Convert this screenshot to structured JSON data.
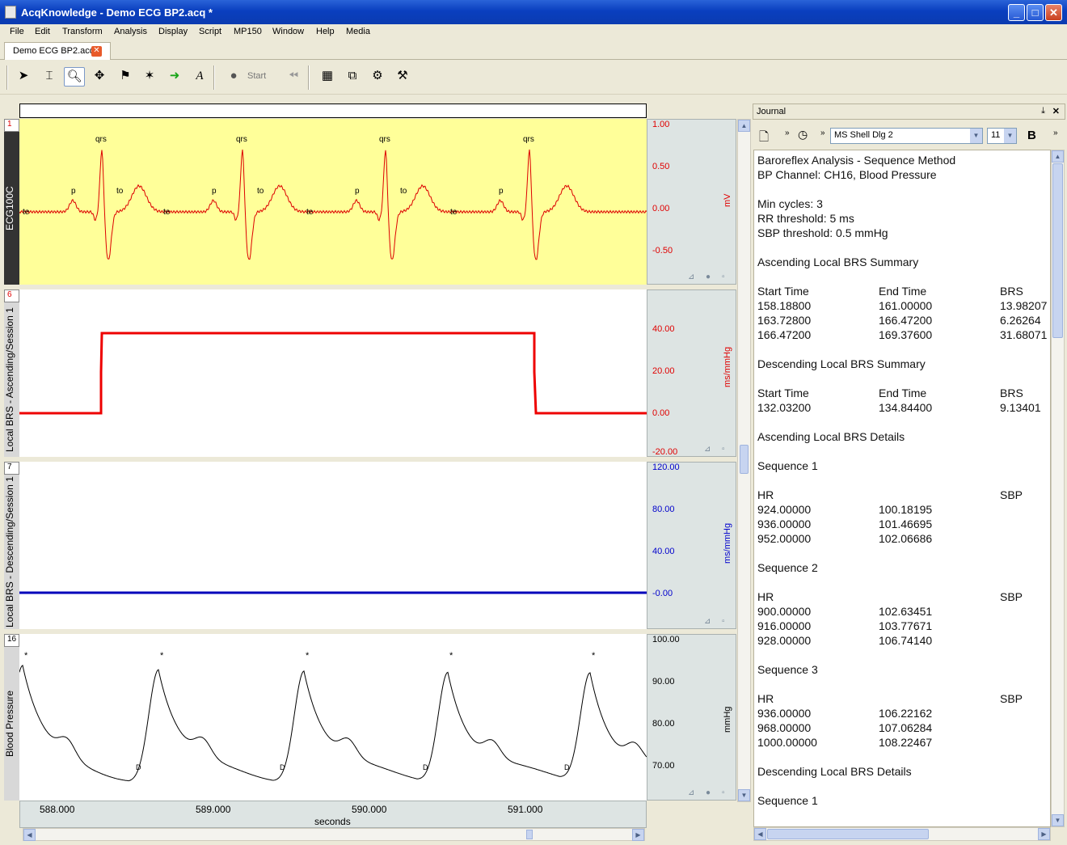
{
  "window": {
    "title": "AcqKnowledge - Demo ECG BP2.acq *"
  },
  "menu": [
    "File",
    "Edit",
    "Transform",
    "Analysis",
    "Display",
    "Script",
    "MP150",
    "Window",
    "Help",
    "Media"
  ],
  "doc_tab": {
    "label": "Demo ECG BP2.acq"
  },
  "toolbar": {
    "start_label": "Start"
  },
  "channels": [
    {
      "num": "1",
      "name": "ECG100C",
      "unit": "mV",
      "ticks": [
        "1.00",
        "0.50",
        "0.00",
        "-0.50"
      ],
      "tick_color": "#e00000",
      "bg": "#ffff99",
      "trace_color": "#dd0000"
    },
    {
      "num": "6",
      "name": "Local BRS - Ascending/Session 1",
      "unit": "ms/mmHg",
      "ticks": [
        "40.00",
        "20.00",
        "0.00",
        "-20.00"
      ],
      "tick_color": "#e00000",
      "bg": "#ffffff",
      "trace_color": "#ee0000"
    },
    {
      "num": "7",
      "name": "Local BRS - Descending/Session 1",
      "unit": "ms/mmHg",
      "ticks": [
        "120.00",
        "80.00",
        "40.00",
        "-0.00"
      ],
      "tick_color": "#0000cc",
      "bg": "#ffffff",
      "trace_color": "#0000bb"
    },
    {
      "num": "16",
      "name": "Blood Pressure",
      "unit": "mmHg",
      "ticks": [
        "100.00",
        "90.00",
        "80.00",
        "70.00"
      ],
      "tick_color": "#000000",
      "bg": "#ffffff",
      "trace_color": "#000000"
    }
  ],
  "ecg_markers": [
    "qrs",
    "p",
    "te",
    "to",
    "qrs",
    "p",
    "te",
    "to",
    "qrs",
    "p",
    "te",
    "to",
    "qrs",
    "p",
    "te"
  ],
  "bp_markers": {
    "peak": "*",
    "trough": "D"
  },
  "xaxis": {
    "ticks": [
      "588.000",
      "589.000",
      "590.000",
      "591.000"
    ],
    "label": "seconds"
  },
  "journal": {
    "title": "Journal",
    "font": "MS Shell Dlg 2",
    "size": "11",
    "bold_label": "B",
    "lines": [
      [
        "Baroreflex Analysis - Sequence Method"
      ],
      [
        "BP Channel:  CH16, Blood Pressure"
      ],
      [
        ""
      ],
      [
        "Min cycles:  3"
      ],
      [
        "RR threshold:  5 ms"
      ],
      [
        "SBP threshold:  0.5 mmHg"
      ],
      [
        ""
      ],
      [
        "Ascending Local BRS Summary"
      ],
      [
        ""
      ],
      [
        "Start Time",
        "End Time",
        "BRS"
      ],
      [
        "158.18800",
        "161.00000",
        "13.98207"
      ],
      [
        "163.72800",
        "166.47200",
        "6.26264"
      ],
      [
        "166.47200",
        "169.37600",
        "31.68071"
      ],
      [
        ""
      ],
      [
        "Descending Local BRS Summary"
      ],
      [
        ""
      ],
      [
        "Start Time",
        "End Time",
        "BRS"
      ],
      [
        "132.03200",
        "134.84400",
        "9.13401"
      ],
      [
        ""
      ],
      [
        "Ascending Local BRS Details"
      ],
      [
        ""
      ],
      [
        "Sequence 1"
      ],
      [
        ""
      ],
      [
        "HR",
        "",
        "SBP"
      ],
      [
        "924.00000",
        "100.18195"
      ],
      [
        "936.00000",
        "101.46695"
      ],
      [
        "952.00000",
        "102.06686"
      ],
      [
        ""
      ],
      [
        "Sequence 2"
      ],
      [
        ""
      ],
      [
        "HR",
        "",
        "SBP"
      ],
      [
        "900.00000",
        "102.63451"
      ],
      [
        "916.00000",
        "103.77671"
      ],
      [
        "928.00000",
        "106.74140"
      ],
      [
        ""
      ],
      [
        "Sequence 3"
      ],
      [
        ""
      ],
      [
        "HR",
        "",
        "SBP"
      ],
      [
        "936.00000",
        "106.22162"
      ],
      [
        "968.00000",
        "107.06284"
      ],
      [
        "1000.00000",
        "108.22467"
      ],
      [
        ""
      ],
      [
        "Descending Local BRS Details"
      ],
      [
        ""
      ],
      [
        "Sequence 1"
      ]
    ]
  }
}
